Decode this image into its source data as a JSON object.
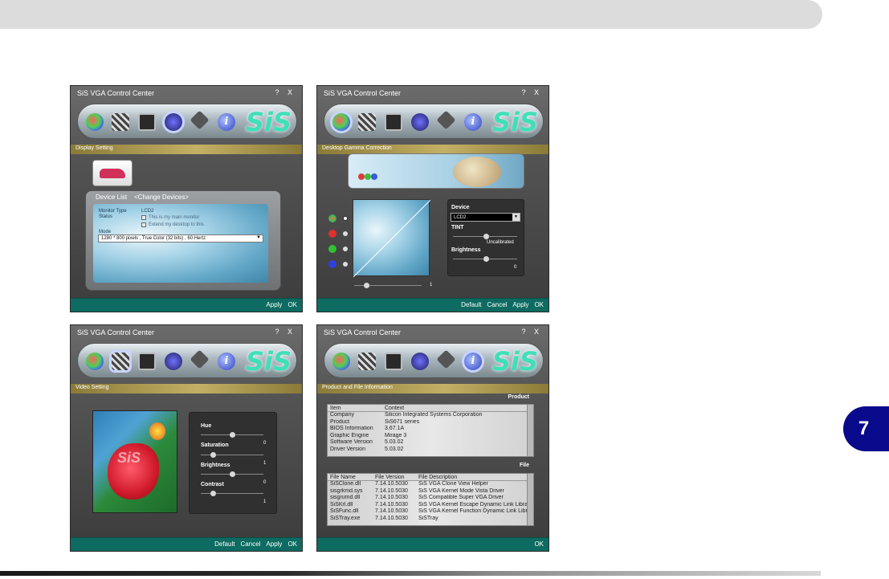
{
  "page": {
    "chapter_number": "7"
  },
  "win1": {
    "title": "SiS VGA Control Center",
    "controls": "? X",
    "logo": "SiS",
    "section": "Display Setting",
    "device_list_label": "Device List",
    "change_devices_label": "<Change Devices>",
    "monitor_type_label": "Monitor Type",
    "monitor_type_value": "LCD2",
    "status_label": "Status",
    "status_check1": "This is my main monitor",
    "status_check2": "Extend my desktop to this",
    "mode_label": "Mode",
    "mode_value": "1280 * 800 pixels , True Color (32 bits) , 60 Hertz",
    "apply": "Apply",
    "ok": "OK"
  },
  "win2": {
    "title": "SiS VGA Control Center",
    "controls": "? X",
    "logo": "SiS",
    "section": "Desktop Gamma Correction",
    "device_label": "Device",
    "device_value": "LCD2",
    "tint_label": "TINT",
    "tint_value": "Uncalibrated",
    "brightness_label": "Brightness",
    "brightness_value": "0",
    "gamma_value": "1",
    "default": "Default",
    "cancel": "Cancel",
    "apply": "Apply",
    "ok": "OK"
  },
  "win3": {
    "title": "SiS VGA Control Center",
    "controls": "? X",
    "logo": "SiS",
    "section": "Video Setting",
    "hue_label": "Hue",
    "hue_value": "0",
    "saturation_label": "Saturation",
    "saturation_value": "1",
    "brightness_label": "Brightness",
    "brightness_value": "0",
    "contrast_label": "Contrast",
    "contrast_value": "1",
    "preview_watermark": "SiS",
    "default": "Default",
    "cancel": "Cancel",
    "apply": "Apply",
    "ok": "OK"
  },
  "win4": {
    "title": "SiS VGA Control Center",
    "controls": "? X",
    "logo": "SiS",
    "section": "Product and File Information",
    "product_heading": "Product",
    "file_heading": "File",
    "product_columns": [
      "Item",
      "Context"
    ],
    "product_rows": [
      [
        "Company",
        "Silicon Integrated Systems Corporation"
      ],
      [
        "Product",
        "SiS671 series"
      ],
      [
        "BIOS Information",
        "3.67.1A"
      ],
      [
        "Graphic Engine",
        "Mirage 3"
      ],
      [
        "Software Version",
        "5.03.02"
      ],
      [
        "Driver Version",
        "5.03.02"
      ]
    ],
    "file_columns": [
      "File Name",
      "File Version",
      "File Description"
    ],
    "file_rows": [
      [
        "SiSClone.dll",
        "7.14.10.5030",
        "SiS VGA Clone View Helper"
      ],
      [
        "sisgrkmd.sys",
        "7.14.10.5030",
        "SiS VGA Kernel Mode Vista Driver"
      ],
      [
        "sisgrumd.dll",
        "7.14.10.5030",
        "SiS Compatible Super VGA Driver"
      ],
      [
        "SiSKrl.dll",
        "7.14.10.5030",
        "SiS VGA Kernel Escape Dynamic Link Libra"
      ],
      [
        "SiSFunc.dll",
        "7.14.10.5030",
        "SiS VGA Kernel Function Dynamic Link Libr"
      ],
      [
        "SiSTray.exe",
        "7.14.10.5030",
        "SiSTray"
      ]
    ],
    "ok": "OK"
  }
}
